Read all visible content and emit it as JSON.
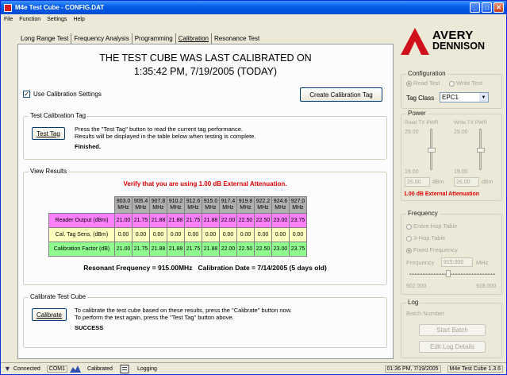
{
  "window": {
    "title": "M4e Test Cube - CONFIG.DAT"
  },
  "menu": [
    "File",
    "Function",
    "Settings",
    "Help"
  ],
  "tabs": [
    "Long Range Test",
    "Frequency Analysis",
    "Programming",
    "Calibration",
    "Resonance Test"
  ],
  "calibration": {
    "headline1": "THE TEST CUBE WAS LAST CALIBRATED ON",
    "headline2": "1:35:42 PM, 7/19/2005 (TODAY)",
    "use_settings_label": "Use Calibration Settings",
    "use_settings_checked": true,
    "create_tag_button": "Create Calibration Tag",
    "test_tag_group": {
      "label": "Test Calibration Tag",
      "button": "Test Tag",
      "text1": "Press the \"Test Tag\" button to read the current tag performance.",
      "text2": "Results will be displayed in the table below when testing is complete.",
      "status": "Finished."
    },
    "results_group": {
      "label": "View Results",
      "warning": "Verify that you are using 1.00 dB External Attenuation.",
      "freq_headers": [
        [
          "903.0",
          "MHz"
        ],
        [
          "905.4",
          "MHz"
        ],
        [
          "907.8",
          "MHz"
        ],
        [
          "910.2",
          "MHz"
        ],
        [
          "912.6",
          "MHz"
        ],
        [
          "915.0",
          "MHz"
        ],
        [
          "917.4",
          "MHz"
        ],
        [
          "919.8",
          "MHz"
        ],
        [
          "922.2",
          "MHz"
        ],
        [
          "924.6",
          "MHz"
        ],
        [
          "927.0",
          "MHz"
        ]
      ],
      "rows": [
        {
          "label": "Reader Output (dBm)",
          "values": [
            "21.00",
            "21.75",
            "21.88",
            "21.88",
            "21.75",
            "21.88",
            "22.00",
            "22.50",
            "22.50",
            "23.00",
            "23.75"
          ]
        },
        {
          "label": "Cal. Tag Sens. (dBm)",
          "values": [
            "0.00",
            "0.00",
            "0.00",
            "0.00",
            "0.00",
            "0.00",
            "0.00",
            "0.00",
            "0.00",
            "0.00",
            "0.00"
          ]
        },
        {
          "label": "Calibration Factor (dB)",
          "values": [
            "21.00",
            "21.75",
            "21.88",
            "21.88",
            "21.75",
            "21.88",
            "22.00",
            "22.50",
            "22.50",
            "23.00",
            "23.75"
          ]
        }
      ],
      "summary": "Resonant Frequency = 915.00MHz   Calibration Date = 7/14/2005 (5 days old)"
    },
    "calibrate_group": {
      "label": "Calibrate Test Cube",
      "button": "Calibrate",
      "text1": "To calibrate the test cube based on these results, press the \"Calibrate\" button now.",
      "text2": "To perform the test again, press the \"Test Tag\" button above.",
      "status": "SUCCESS"
    }
  },
  "sidebar": {
    "logo_line1": "AVERY",
    "logo_line2": "DENNISON",
    "configuration": {
      "label": "Configuration",
      "radio_read": "Read Test",
      "radio_write": "Write Test",
      "tag_class_label": "Tag Class",
      "tag_class_value": "EPC1"
    },
    "power": {
      "label": "Power",
      "read_label": "Read TX PWR",
      "write_label": "Write TX PWR",
      "max": "29.00",
      "min": "19.00",
      "read_value": "26.00",
      "write_value": "26.00",
      "unit": "dBm",
      "attenuation": "1.00 dB External Attenuation"
    },
    "frequency": {
      "label": "Frequency",
      "opt1": "Entire Hop Table",
      "opt2": "3-Hop Table",
      "opt3": "Fixed Frequency",
      "freq_label": "Frequency",
      "freq_value": "915.000",
      "freq_unit": "MHz",
      "min": "902.000",
      "max": "928.000"
    },
    "log": {
      "label": "Log",
      "batch_label": "Batch Number",
      "start_button": "Start Batch",
      "edit_button": "Edit Log Details"
    }
  },
  "status": {
    "connected": "Connected",
    "port": "COM1",
    "calibrated": "Calibrated",
    "logging": "Logging",
    "datetime": "01:36 PM, 7/19/2005",
    "version": "M4e Test Cube 1.3.6"
  },
  "colors": {
    "reader_row": "#ff80ff",
    "sens_row": "#ffffc0",
    "factor_row": "#90ff90",
    "warning": "#e00000",
    "logo": "#d0101a"
  }
}
